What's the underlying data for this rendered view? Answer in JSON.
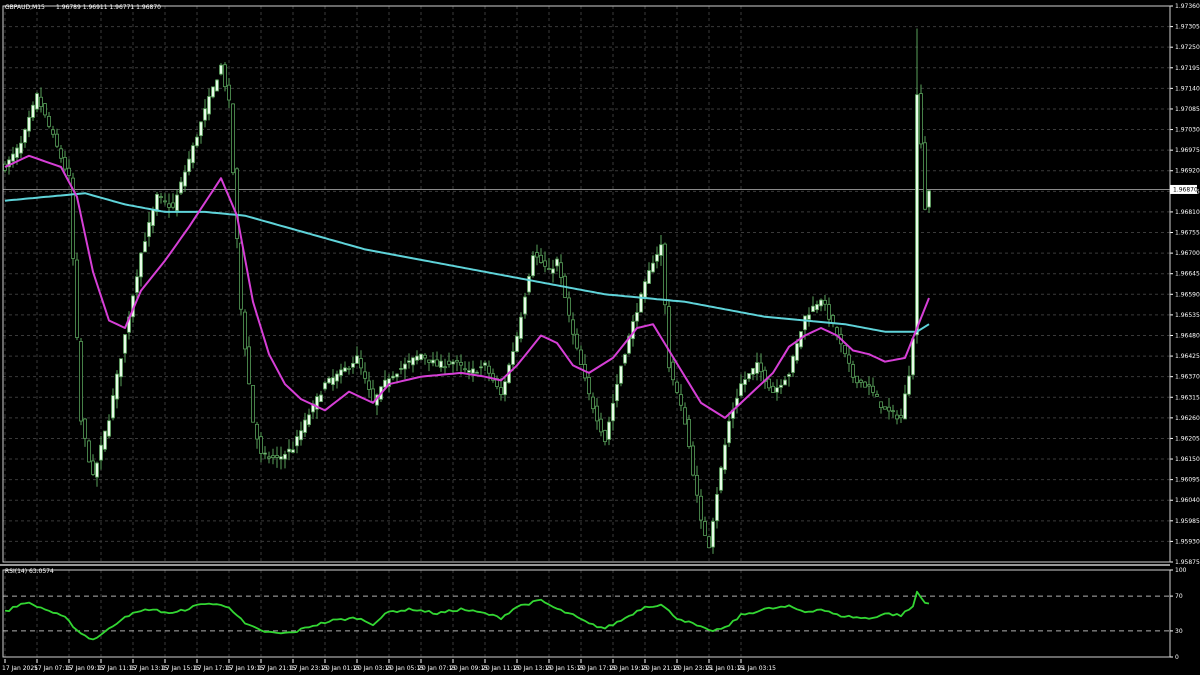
{
  "header": {
    "symbol": "GBPAUD,M15",
    "ohlc": "1.96789 1.96911 1.96771 1.96870",
    "rsi_label": "RSI(14) 63.0574"
  },
  "current_price": "1.96870",
  "colors": {
    "background": "#000000",
    "grid": "#3a3a3a",
    "candle_bull": "#e8fbe8",
    "candle_bear": "#000000",
    "wick": "#58a05a",
    "ma_fast": "#d63fd6",
    "ma_slow": "#5fd3d9",
    "rsi": "#33d633",
    "text": "#ffffff"
  },
  "chart_data": [
    {
      "type": "candlestick",
      "title": "GBPAUD,M15",
      "y_ticks": [
        "1.97360",
        "1.97305",
        "1.97250",
        "1.97195",
        "1.97140",
        "1.97085",
        "1.97030",
        "1.96975",
        "1.96920",
        "1.96865",
        "1.96810",
        "1.96755",
        "1.96700",
        "1.96645",
        "1.96590",
        "1.96535",
        "1.96480",
        "1.96425",
        "1.96370",
        "1.96315",
        "1.96260",
        "1.96205",
        "1.96150",
        "1.96095",
        "1.96040",
        "1.95985",
        "1.95930",
        "1.95875"
      ],
      "ylim": [
        1.95875,
        1.9736
      ],
      "x_ticks": [
        "17 Jan 2025",
        "17 Jan 07:15",
        "17 Jan 09:15",
        "17 Jan 11:15",
        "17 Jan 13:15",
        "17 Jan 15:15",
        "17 Jan 17:15",
        "17 Jan 19:15",
        "17 Jan 21:15",
        "17 Jan 23:15",
        "20 Jan 01:15",
        "20 Jan 03:15",
        "20 Jan 05:15",
        "20 Jan 07:15",
        "20 Jan 09:15",
        "20 Jan 11:15",
        "20 Jan 13:15",
        "20 Jan 15:15",
        "20 Jan 17:15",
        "20 Jan 19:15",
        "20 Jan 21:15",
        "20 Jan 23:15",
        "21 Jan 01:15",
        "21 Jan 03:15"
      ],
      "bar_count": 232,
      "bars_per_tick": 8,
      "close_anchors": [
        [
          0,
          1.9693
        ],
        [
          4,
          1.9699
        ],
        [
          8,
          1.9712
        ],
        [
          12,
          1.9701
        ],
        [
          16,
          1.969
        ],
        [
          19,
          1.9625
        ],
        [
          22,
          1.961
        ],
        [
          26,
          1.9626
        ],
        [
          30,
          1.9648
        ],
        [
          34,
          1.967
        ],
        [
          38,
          1.9685
        ],
        [
          42,
          1.9682
        ],
        [
          46,
          1.9695
        ],
        [
          50,
          1.9708
        ],
        [
          54,
          1.972
        ],
        [
          56,
          1.971
        ],
        [
          59,
          1.9655
        ],
        [
          62,
          1.9625
        ],
        [
          64,
          1.9616
        ],
        [
          68,
          1.9615
        ],
        [
          72,
          1.9618
        ],
        [
          76,
          1.9627
        ],
        [
          80,
          1.9635
        ],
        [
          84,
          1.9638
        ],
        [
          88,
          1.9642
        ],
        [
          92,
          1.963
        ],
        [
          96,
          1.9637
        ],
        [
          100,
          1.964
        ],
        [
          104,
          1.9643
        ],
        [
          108,
          1.964
        ],
        [
          112,
          1.9641
        ],
        [
          116,
          1.9638
        ],
        [
          120,
          1.964
        ],
        [
          124,
          1.9632
        ],
        [
          128,
          1.9648
        ],
        [
          132,
          1.967
        ],
        [
          136,
          1.9665
        ],
        [
          138,
          1.9668
        ],
        [
          142,
          1.9648
        ],
        [
          146,
          1.9632
        ],
        [
          150,
          1.962
        ],
        [
          154,
          1.964
        ],
        [
          158,
          1.9655
        ],
        [
          162,
          1.9668
        ],
        [
          164,
          1.9672
        ],
        [
          166,
          1.964
        ],
        [
          170,
          1.9625
        ],
        [
          174,
          1.9598
        ],
        [
          176,
          1.9592
        ],
        [
          178,
          1.9606
        ],
        [
          181,
          1.9625
        ],
        [
          184,
          1.9635
        ],
        [
          188,
          1.964
        ],
        [
          192,
          1.9633
        ],
        [
          196,
          1.9638
        ],
        [
          200,
          1.9653
        ],
        [
          204,
          1.9658
        ],
        [
          208,
          1.9648
        ],
        [
          212,
          1.9637
        ],
        [
          216,
          1.9634
        ],
        [
          220,
          1.9628
        ],
        [
          224,
          1.9626
        ],
        [
          226,
          1.9638
        ],
        [
          227,
          1.9648
        ],
        [
          228,
          1.9712
        ],
        [
          229,
          1.97
        ],
        [
          230,
          1.9682
        ],
        [
          231,
          1.9687
        ]
      ],
      "ma_fast_anchors": [
        [
          0,
          1.9693
        ],
        [
          6,
          1.9696
        ],
        [
          14,
          1.9693
        ],
        [
          18,
          1.9685
        ],
        [
          22,
          1.9665
        ],
        [
          26,
          1.9652
        ],
        [
          30,
          1.965
        ],
        [
          34,
          1.966
        ],
        [
          40,
          1.9668
        ],
        [
          46,
          1.9677
        ],
        [
          54,
          1.969
        ],
        [
          58,
          1.968
        ],
        [
          62,
          1.9657
        ],
        [
          66,
          1.9643
        ],
        [
          70,
          1.9635
        ],
        [
          74,
          1.9631
        ],
        [
          80,
          1.9628
        ],
        [
          86,
          1.9633
        ],
        [
          92,
          1.963
        ],
        [
          96,
          1.9635
        ],
        [
          104,
          1.9637
        ],
        [
          114,
          1.9638
        ],
        [
          120,
          1.9637
        ],
        [
          124,
          1.9636
        ],
        [
          128,
          1.964
        ],
        [
          134,
          1.9648
        ],
        [
          138,
          1.9646
        ],
        [
          142,
          1.964
        ],
        [
          146,
          1.9638
        ],
        [
          152,
          1.9642
        ],
        [
          158,
          1.965
        ],
        [
          162,
          1.9651
        ],
        [
          166,
          1.9644
        ],
        [
          170,
          1.9637
        ],
        [
          174,
          1.963
        ],
        [
          180,
          1.9626
        ],
        [
          186,
          1.9632
        ],
        [
          192,
          1.9638
        ],
        [
          196,
          1.9645
        ],
        [
          200,
          1.9648
        ],
        [
          204,
          1.965
        ],
        [
          208,
          1.9648
        ],
        [
          212,
          1.9644
        ],
        [
          216,
          1.9643
        ],
        [
          220,
          1.9641
        ],
        [
          225,
          1.9642
        ],
        [
          228,
          1.965
        ],
        [
          231,
          1.9658
        ]
      ],
      "ma_slow_anchors": [
        [
          0,
          1.9684
        ],
        [
          10,
          1.9685
        ],
        [
          20,
          1.9686
        ],
        [
          30,
          1.9683
        ],
        [
          40,
          1.9681
        ],
        [
          50,
          1.9681
        ],
        [
          60,
          1.968
        ],
        [
          70,
          1.9677
        ],
        [
          80,
          1.9674
        ],
        [
          90,
          1.9671
        ],
        [
          100,
          1.9669
        ],
        [
          110,
          1.9667
        ],
        [
          120,
          1.9665
        ],
        [
          130,
          1.9663
        ],
        [
          140,
          1.9661
        ],
        [
          150,
          1.9659
        ],
        [
          160,
          1.9658
        ],
        [
          170,
          1.9657
        ],
        [
          180,
          1.9655
        ],
        [
          190,
          1.9653
        ],
        [
          200,
          1.9652
        ],
        [
          210,
          1.9651
        ],
        [
          220,
          1.9649
        ],
        [
          228,
          1.9649
        ],
        [
          231,
          1.9651
        ]
      ]
    },
    {
      "type": "line",
      "title": "RSI(14) 63.0574",
      "y_ticks": [
        "100",
        "70",
        "30",
        "0"
      ],
      "levels": [
        70,
        30
      ],
      "ylim": [
        0,
        100
      ],
      "rsi_anchors": [
        [
          0,
          52
        ],
        [
          5,
          63
        ],
        [
          10,
          55
        ],
        [
          15,
          45
        ],
        [
          19,
          27
        ],
        [
          22,
          20
        ],
        [
          26,
          32
        ],
        [
          30,
          47
        ],
        [
          36,
          55
        ],
        [
          42,
          50
        ],
        [
          50,
          62
        ],
        [
          56,
          58
        ],
        [
          60,
          38
        ],
        [
          64,
          30
        ],
        [
          68,
          27
        ],
        [
          72,
          28
        ],
        [
          76,
          35
        ],
        [
          82,
          42
        ],
        [
          88,
          45
        ],
        [
          92,
          38
        ],
        [
          96,
          52
        ],
        [
          102,
          55
        ],
        [
          108,
          50
        ],
        [
          114,
          55
        ],
        [
          120,
          50
        ],
        [
          124,
          45
        ],
        [
          128,
          58
        ],
        [
          134,
          65
        ],
        [
          138,
          55
        ],
        [
          142,
          48
        ],
        [
          146,
          38
        ],
        [
          150,
          33
        ],
        [
          154,
          42
        ],
        [
          160,
          58
        ],
        [
          164,
          60
        ],
        [
          168,
          45
        ],
        [
          172,
          38
        ],
        [
          176,
          30
        ],
        [
          180,
          33
        ],
        [
          184,
          48
        ],
        [
          190,
          55
        ],
        [
          196,
          58
        ],
        [
          200,
          52
        ],
        [
          204,
          55
        ],
        [
          208,
          48
        ],
        [
          212,
          46
        ],
        [
          216,
          44
        ],
        [
          220,
          50
        ],
        [
          224,
          48
        ],
        [
          227,
          58
        ],
        [
          228,
          75
        ],
        [
          230,
          62
        ],
        [
          231,
          63
        ]
      ]
    }
  ]
}
